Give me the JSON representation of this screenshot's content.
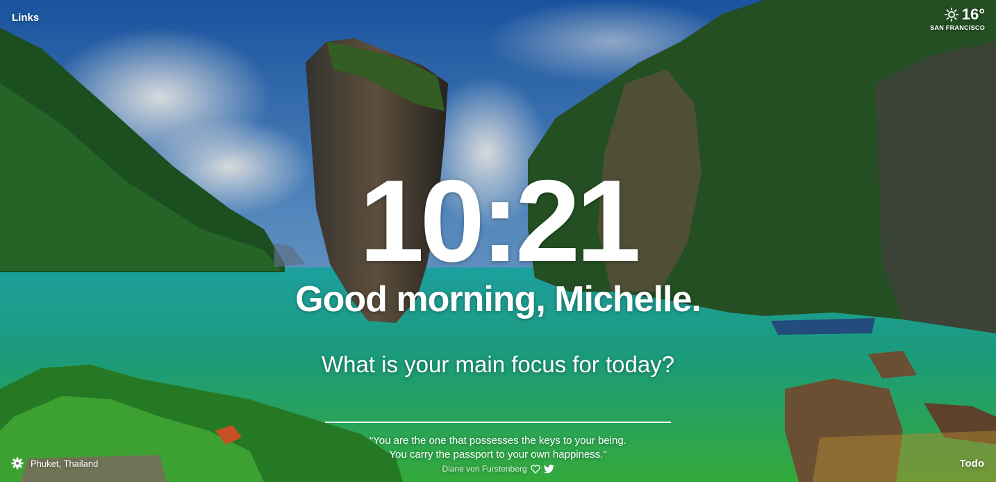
{
  "top_left": {
    "links_label": "Links"
  },
  "weather": {
    "temperature": "16°",
    "location": "SAN FRANCISCO",
    "icon": "sun-icon"
  },
  "clock": {
    "time": "10:21"
  },
  "greeting": {
    "text": "Good morning, Michelle."
  },
  "focus": {
    "question": "What is your main focus for today?",
    "value": ""
  },
  "quote": {
    "line1": "“You are the one that possesses the keys to your being.",
    "line2": "You carry the passport to your own happiness.”",
    "author": "Diane von Furstenberg"
  },
  "bottom_left": {
    "location": "Phuket, Thailand",
    "icon": "gear-icon"
  },
  "bottom_right": {
    "todo_label": "Todo"
  },
  "colors": {
    "sky": "#3a7fd0",
    "water": "#1fb8a8",
    "text": "#ffffff"
  }
}
